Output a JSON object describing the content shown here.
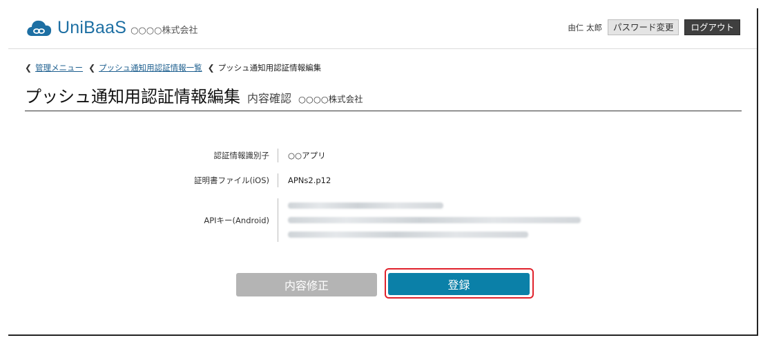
{
  "header": {
    "logo_text": "UniBaaS",
    "company_name": "○○○○株式会社",
    "user_name": "由仁 太郎",
    "password_change_label": "パスワード変更",
    "logout_label": "ログアウト"
  },
  "breadcrumb": {
    "items": [
      "管理メニュー",
      "プッシュ通知用認証情報一覧"
    ],
    "current": "プッシュ通知用認証情報編集"
  },
  "page": {
    "title": "プッシュ通知用認証情報編集",
    "subtitle": "内容確認",
    "company": "○○○○株式会社"
  },
  "details": {
    "identifier_label": "認証情報識別子",
    "identifier_value": "○○アプリ",
    "certificate_label": "証明書ファイル(iOS)",
    "certificate_value": "APNs2.p12",
    "api_key_label": "APIキー(Android)"
  },
  "actions": {
    "edit_label": "内容修正",
    "register_label": "登録"
  },
  "colors": {
    "brand": "#1d6fa3",
    "primary_button": "#0b80a8",
    "secondary_button": "#b4b4b4",
    "highlight": "#e0212b"
  }
}
